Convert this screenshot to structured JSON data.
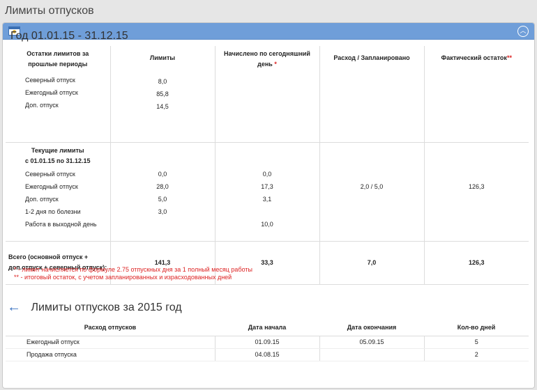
{
  "page_title": "Лимиты отпусков",
  "year_title": "Год 01.01.15 - 31.12.15",
  "limits_headers": {
    "col0": "Остатки лимитов за прошлые периоды",
    "col1": "Лимиты",
    "col2": "Начислено по сегодняшний день",
    "col2_star": "*",
    "col3": "Расход / Запланировано",
    "col4": "Фактический остаток",
    "col4_star": "**"
  },
  "previous_rows": [
    {
      "label": "Северный отпуск",
      "limit": "8,0"
    },
    {
      "label": "Ежегодный отпуск",
      "limit": "85,8"
    },
    {
      "label": "Доп. отпуск",
      "limit": "14,5"
    }
  ],
  "current_title_line1": "Текущие лимиты",
  "current_title_line2": "с 01.01.15 по 31.12.15",
  "current_rows": [
    {
      "label": "Северный отпуск",
      "limit": "0,0",
      "accrued": "0,0",
      "spent": "",
      "actual": ""
    },
    {
      "label": "Ежегодный отпуск",
      "limit": "28,0",
      "accrued": "17,3",
      "spent": "2,0 / 5,0",
      "actual": "126,3"
    },
    {
      "label": "Доп. отпуск",
      "limit": "5,0",
      "accrued": "3,1",
      "spent": "",
      "actual": ""
    },
    {
      "label": "1-2 дня по болезни",
      "limit": "3,0",
      "accrued": "",
      "spent": "",
      "actual": ""
    },
    {
      "label": "Работа в выходной день",
      "limit": "",
      "accrued": "10,0",
      "spent": "",
      "actual": ""
    }
  ],
  "total": {
    "label_line1": "Всего (основной отпуск +",
    "label_line2": "доп.отпуск + северный отпуск):",
    "limit": "141,3",
    "accrued": "33,3",
    "spent": "7,0",
    "actual": "126,3"
  },
  "notes": {
    "note1": "* - лимит начисляется по формуле 2.75 отпускных дня за 1 полный месяц работы",
    "note2": "** - итоговый остаток, с учетом запланированных и израсходованных дней"
  },
  "section2_title": "Лимиты отпусков за 2015 год",
  "vacation_headers": [
    "Расход отпусков",
    "Дата начала",
    "Дата окончания",
    "Кол-во дней"
  ],
  "vacation_rows": [
    {
      "type": "Ежегодный отпуск",
      "start": "01.09.15",
      "end": "05.09.15",
      "days": "5"
    },
    {
      "type": "Продажа отпуска",
      "start": "04.08.15",
      "end": "",
      "days": "2"
    }
  ]
}
